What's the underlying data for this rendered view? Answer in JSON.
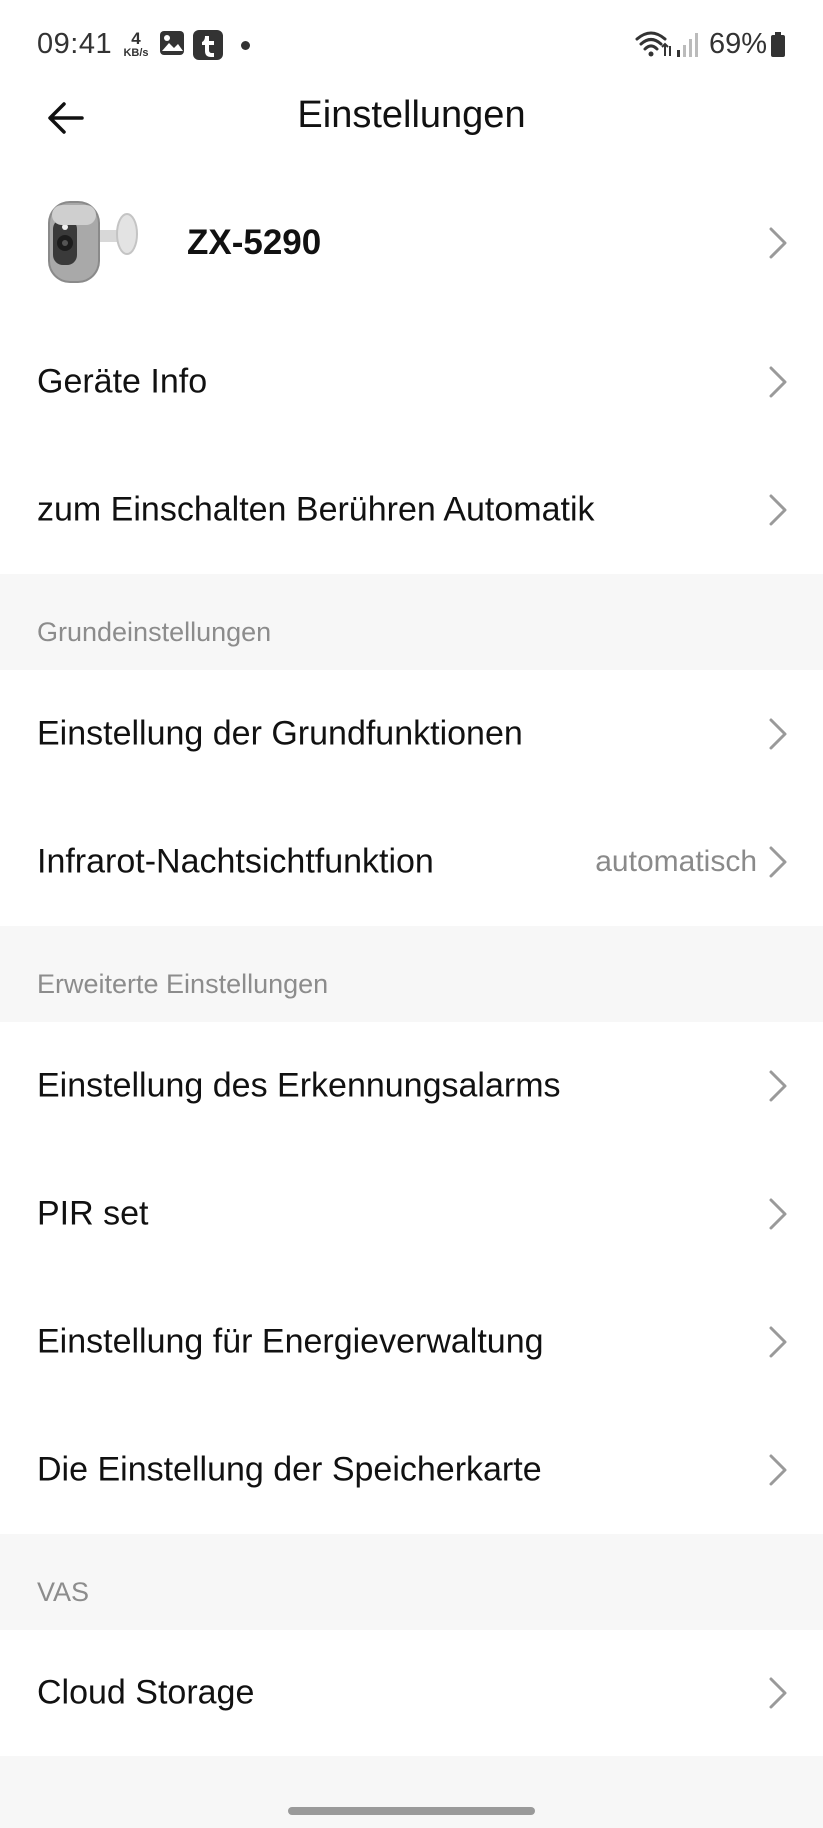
{
  "status_bar": {
    "time": "09:41",
    "speed_value": "4",
    "speed_unit": "KB/s",
    "battery_percent": "69%",
    "icons": [
      "gallery-icon",
      "tumblr-icon",
      "notification-dot",
      "wifi-icon",
      "signal-icon",
      "battery-icon"
    ]
  },
  "header": {
    "title": "Einstellungen",
    "back_icon": "arrow-left-icon"
  },
  "device": {
    "name": "ZX-5290",
    "image_icon": "camera-device-icon"
  },
  "rows_top": [
    {
      "label": "Geräte Info"
    },
    {
      "label": "zum Einschalten Berühren Automatik"
    }
  ],
  "sections": [
    {
      "title": "Grundeinstellungen",
      "items": [
        {
          "label": "Einstellung der Grundfunktionen",
          "value": ""
        },
        {
          "label": "Infrarot-Nachtsichtfunktion",
          "value": "automatisch"
        }
      ]
    },
    {
      "title": "Erweiterte Einstellungen",
      "items": [
        {
          "label": "Einstellung des Erkennungsalarms",
          "value": ""
        },
        {
          "label": "PIR set",
          "value": ""
        },
        {
          "label": "Einstellung für Energieverwaltung",
          "value": ""
        },
        {
          "label": "Die Einstellung der Speicherkarte",
          "value": ""
        }
      ]
    },
    {
      "title": "VAS",
      "items": [
        {
          "label": "Cloud Storage",
          "value": ""
        }
      ]
    }
  ],
  "colors": {
    "section_background": "#f7f7f7",
    "section_text": "#8c8c8c",
    "chevron": "#9a9a9a",
    "primary_text": "#111111"
  }
}
